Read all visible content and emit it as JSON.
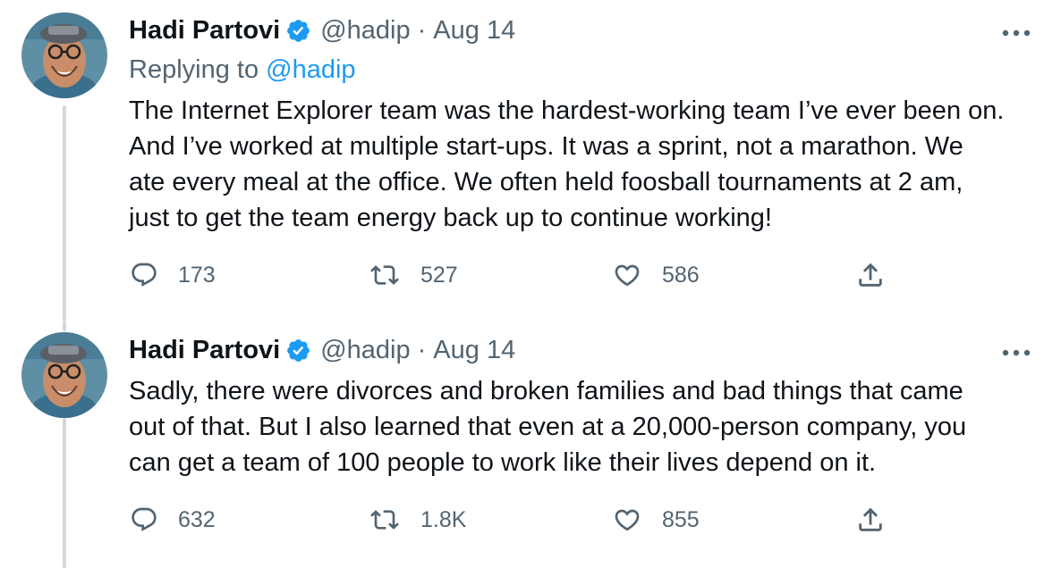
{
  "tweets": [
    {
      "author": {
        "name": "Hadi Partovi",
        "handle": "@hadip"
      },
      "separator": "·",
      "date": "Aug 14",
      "replying_to": {
        "prefix": "Replying to",
        "mention": "@hadip"
      },
      "text_lines": [
        "The Internet Explorer team was the hardest-working team I’ve ever been on.",
        "And I’ve worked at multiple start-ups. It was a sprint, not a marathon. We",
        "ate every meal at the office. We often held foosball tournaments at 2 am,",
        "just to get the team energy back up to continue working!"
      ],
      "stats": {
        "replies": "173",
        "retweets": "527",
        "likes": "586"
      }
    },
    {
      "author": {
        "name": "Hadi Partovi",
        "handle": "@hadip"
      },
      "separator": "·",
      "date": "Aug 14",
      "text_lines": [
        "Sadly, there were divorces and broken families and bad things that came",
        "out of that. But I also learned that even at a 20,000-person company, you",
        "can get a team of 100 people to work like their lives depend on it."
      ],
      "stats": {
        "replies": "632",
        "retweets": "1.8K",
        "likes": "855"
      }
    }
  ],
  "icons": {
    "verified": "verified-badge-icon",
    "more": "more-horizontal-icon",
    "reply": "reply-icon",
    "retweet": "retweet-icon",
    "like": "like-heart-icon",
    "share": "share-icon"
  },
  "colors": {
    "text_primary": "#0f1419",
    "text_secondary": "#536471",
    "accent_blue": "#1d9bf0",
    "thread_line": "#cfd9de"
  }
}
